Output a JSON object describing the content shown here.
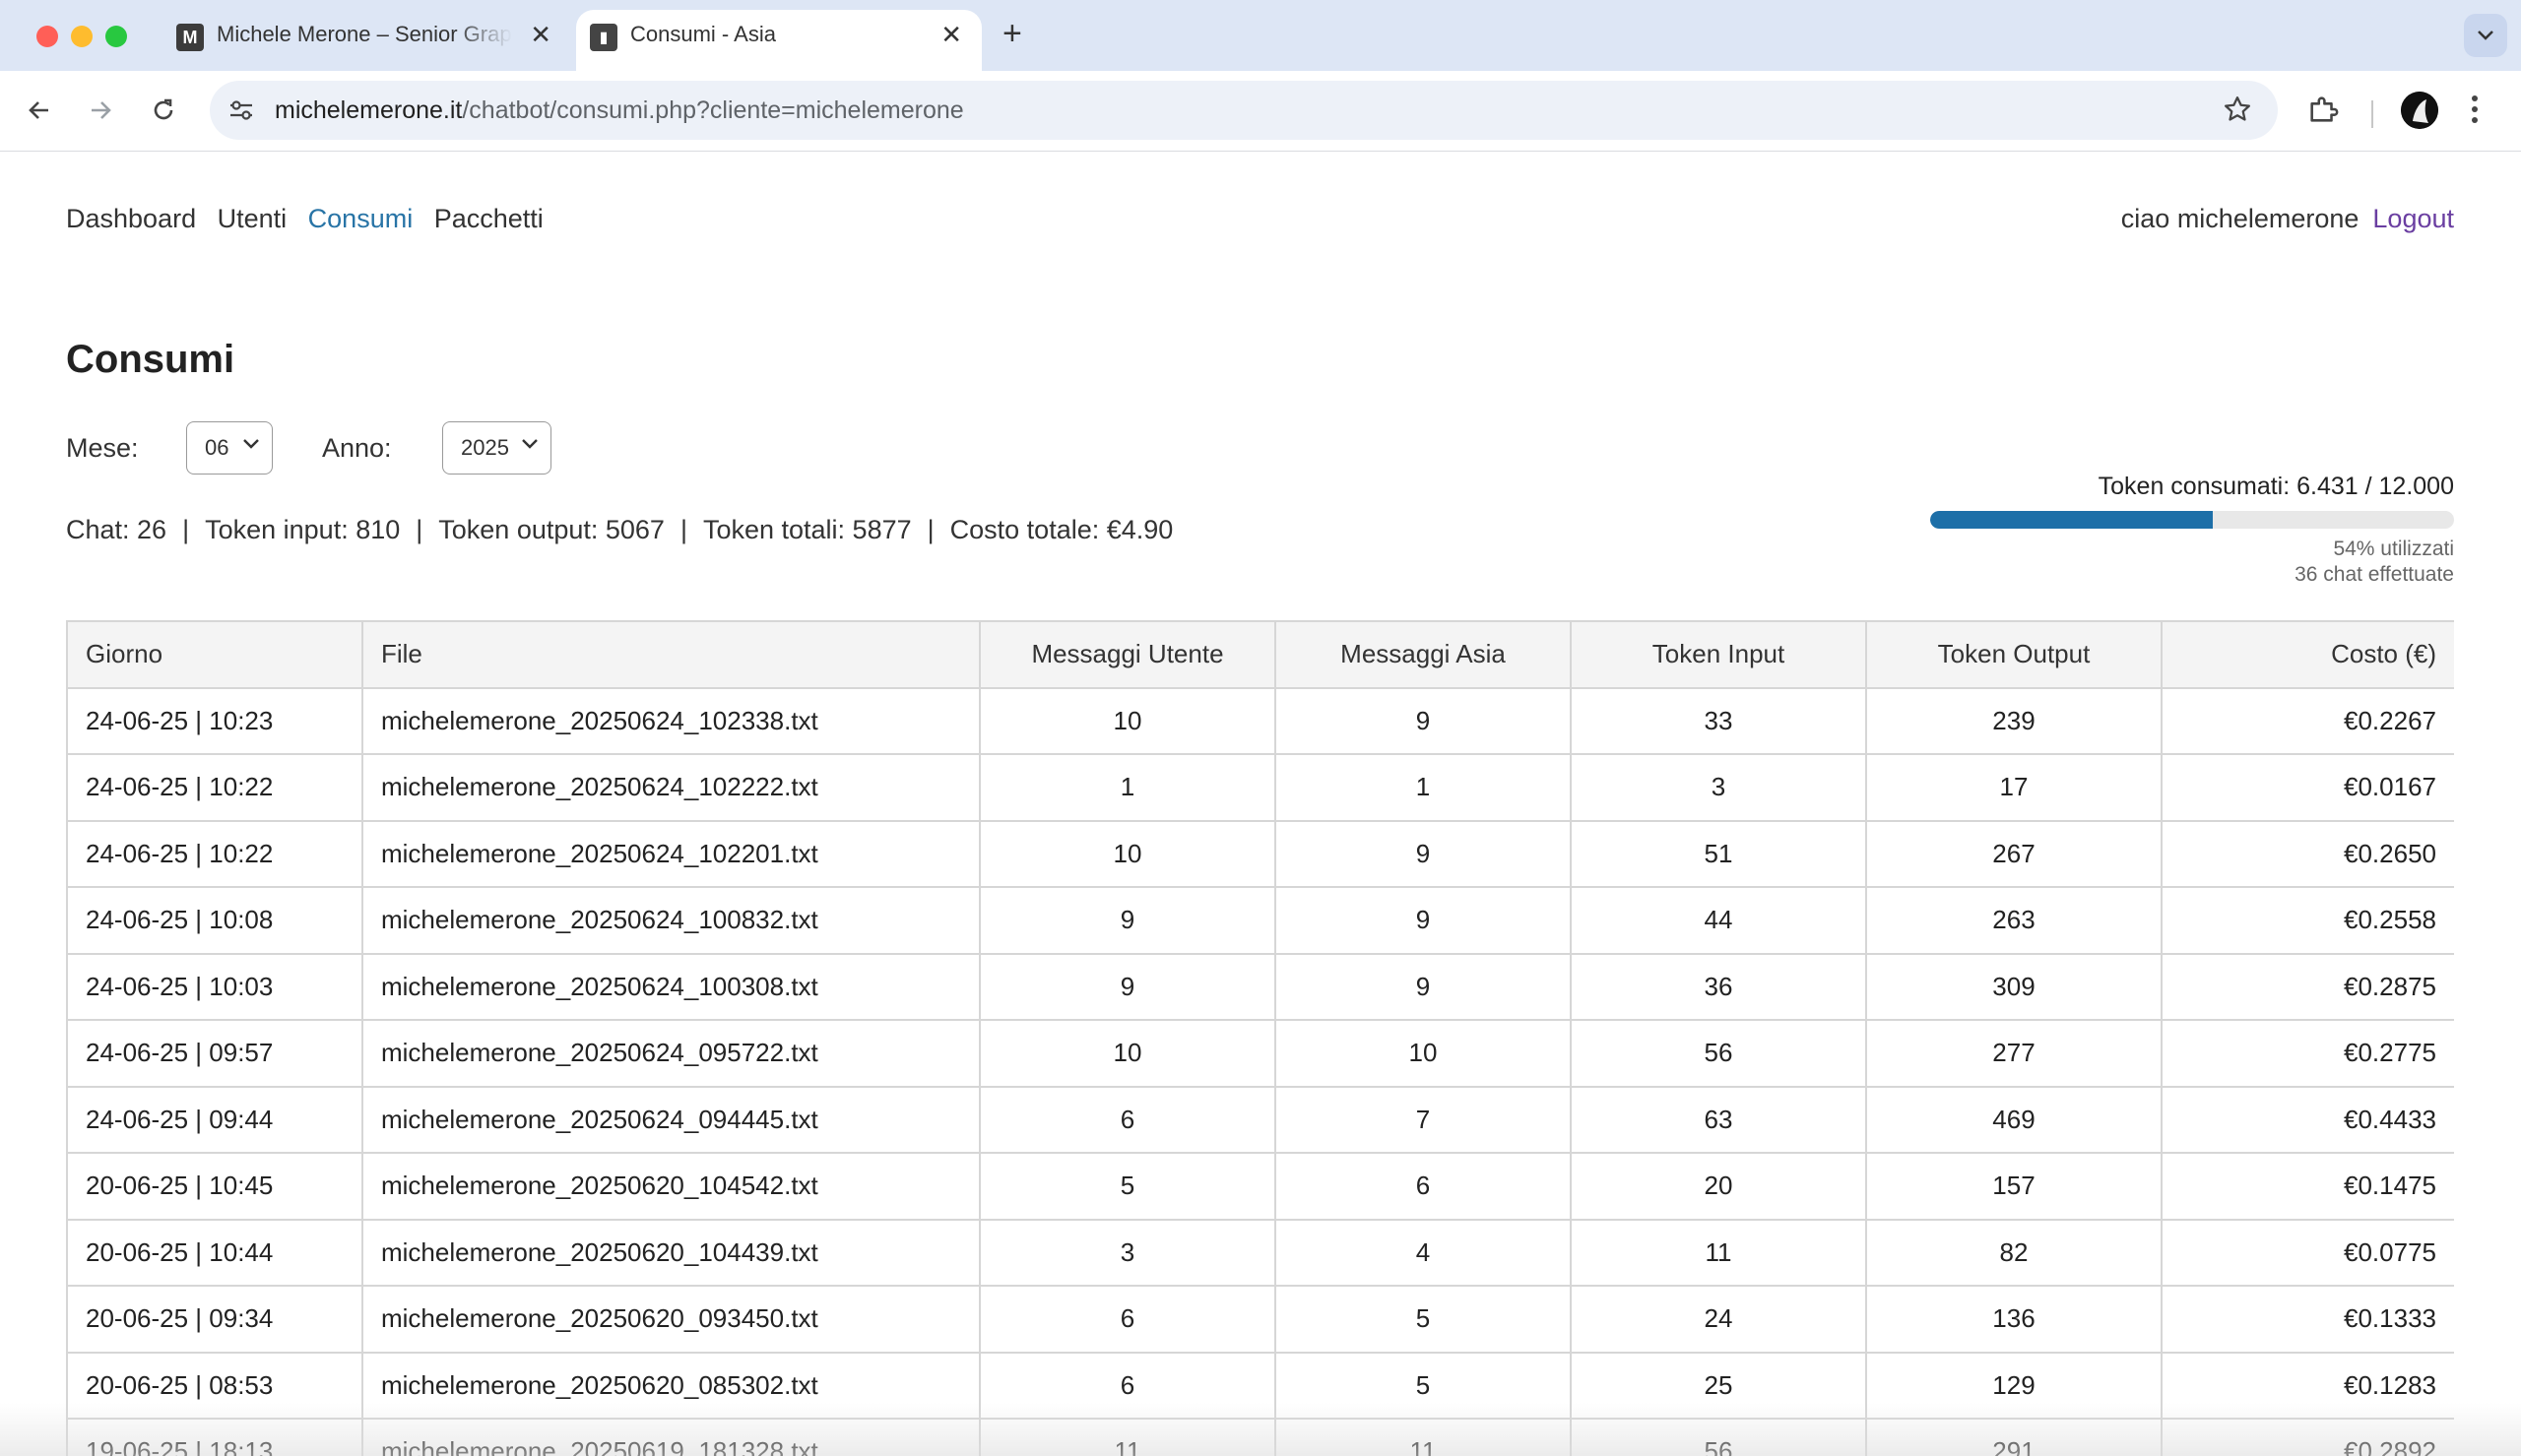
{
  "browser": {
    "tabs": [
      {
        "title": "Michele Merone – Senior Graphic Designer",
        "favicon": "gmail-icon",
        "active": false
      },
      {
        "title": "Consumi - Asia",
        "favicon": "site-icon",
        "active": true
      }
    ],
    "url_host": "michelemerone.it",
    "url_path": "/chatbot/consumi.php?cliente=michelemerone"
  },
  "nav": {
    "items": [
      {
        "label": "Dashboard",
        "active": false
      },
      {
        "label": "Utenti",
        "active": false
      },
      {
        "label": "Consumi",
        "active": true
      },
      {
        "label": "Pacchetti",
        "active": false
      }
    ],
    "greeting": "ciao michelemerone",
    "logout": "Logout"
  },
  "page": {
    "title": "Consumi",
    "filters": {
      "month_label": "Mese:",
      "month_value": "06",
      "year_label": "Anno:",
      "year_value": "2025"
    },
    "summary": {
      "chat": "Chat: 26",
      "token_input": "Token input: 810",
      "token_output": "Token output: 5067",
      "token_totali": "Token totali: 5877",
      "costo_totale": "Costo totale: €4.90",
      "separator": "|"
    },
    "token_usage": {
      "label": "Token consumati: 6.431 / 12.000",
      "percent": 54,
      "percent_text": "54% utilizzati",
      "chats_text": "36 chat effettuate",
      "bar_color": "#1d6fa8"
    }
  },
  "table": {
    "headers": [
      "Giorno",
      "File",
      "Messaggi Utente",
      "Messaggi Asia",
      "Token Input",
      "Token Output",
      "Costo (€)"
    ],
    "rows": [
      [
        "24-06-25 | 10:23",
        "michelemerone_20250624_102338.txt",
        "10",
        "9",
        "33",
        "239",
        "€0.2267"
      ],
      [
        "24-06-25 | 10:22",
        "michelemerone_20250624_102222.txt",
        "1",
        "1",
        "3",
        "17",
        "€0.0167"
      ],
      [
        "24-06-25 | 10:22",
        "michelemerone_20250624_102201.txt",
        "10",
        "9",
        "51",
        "267",
        "€0.2650"
      ],
      [
        "24-06-25 | 10:08",
        "michelemerone_20250624_100832.txt",
        "9",
        "9",
        "44",
        "263",
        "€0.2558"
      ],
      [
        "24-06-25 | 10:03",
        "michelemerone_20250624_100308.txt",
        "9",
        "9",
        "36",
        "309",
        "€0.2875"
      ],
      [
        "24-06-25 | 09:57",
        "michelemerone_20250624_095722.txt",
        "10",
        "10",
        "56",
        "277",
        "€0.2775"
      ],
      [
        "24-06-25 | 09:44",
        "michelemerone_20250624_094445.txt",
        "6",
        "7",
        "63",
        "469",
        "€0.4433"
      ],
      [
        "20-06-25 | 10:45",
        "michelemerone_20250620_104542.txt",
        "5",
        "6",
        "20",
        "157",
        "€0.1475"
      ],
      [
        "20-06-25 | 10:44",
        "michelemerone_20250620_104439.txt",
        "3",
        "4",
        "11",
        "82",
        "€0.0775"
      ],
      [
        "20-06-25 | 09:34",
        "michelemerone_20250620_093450.txt",
        "6",
        "5",
        "24",
        "136",
        "€0.1333"
      ],
      [
        "20-06-25 | 08:53",
        "michelemerone_20250620_085302.txt",
        "6",
        "5",
        "25",
        "129",
        "€0.1283"
      ],
      [
        "19-06-25 | 18:13",
        "michelemerone_20250619_181328.txt",
        "11",
        "11",
        "56",
        "291",
        "€0.2892"
      ]
    ]
  }
}
